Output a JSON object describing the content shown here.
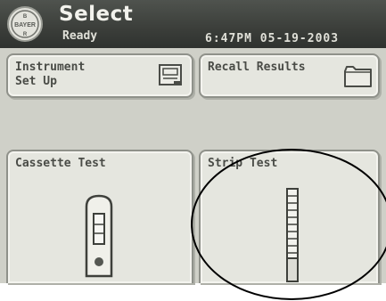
{
  "header": {
    "title": "Select",
    "status": "Ready",
    "datetime": "6:47PM  05-19-2003",
    "logo_icon": "bayer-cross-logo"
  },
  "tiles": [
    {
      "label_line1": "Instrument",
      "label_line2": "Set Up",
      "icon": "instrument-setup-icon"
    },
    {
      "label_line1": "Recall Results",
      "label_line2": "",
      "icon": "folder-icon"
    },
    {
      "label_line1": "Cassette Test",
      "label_line2": "",
      "icon": "cassette-icon"
    },
    {
      "label_line1": "Strip Test",
      "label_line2": "",
      "icon": "test-strip-icon"
    }
  ],
  "colors": {
    "header": "#3b3e3a",
    "screen": "#cfd0c8",
    "tile": "#e5e6df",
    "annotation": "#000000"
  }
}
